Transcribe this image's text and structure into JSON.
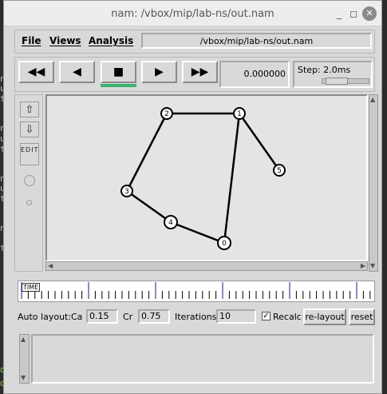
{
  "window": {
    "title": "nam: /vbox/mip/lab-ns/out.nam"
  },
  "menus": {
    "file": "File",
    "views": "Views",
    "analysis": "Analysis"
  },
  "filepath": "/vbox/mip/lab-ns/out.nam",
  "controls": {
    "rewind": "◀◀",
    "back": "◀",
    "stop": "■",
    "play": "▶",
    "fastforward": "▶▶",
    "time": "0.000000",
    "step_label": "Step: 2.0ms"
  },
  "tools": {
    "edit_label": "EDIT"
  },
  "nodes": [
    {
      "id": "0",
      "label": "0"
    },
    {
      "id": "1",
      "label": "1"
    },
    {
      "id": "2",
      "label": "2"
    },
    {
      "id": "3",
      "label": "3"
    },
    {
      "id": "4",
      "label": "4"
    },
    {
      "id": "5",
      "label": "5"
    }
  ],
  "links": [
    [
      "2",
      "1"
    ],
    [
      "2",
      "3"
    ],
    [
      "3",
      "4"
    ],
    [
      "4",
      "0"
    ],
    [
      "0",
      "1"
    ],
    [
      "1",
      "5"
    ]
  ],
  "timeline": {
    "label": "TIME"
  },
  "layout": {
    "auto_label": "Auto layout:",
    "ca_label": "Ca",
    "ca_value": "0.15",
    "cr_label": "Cr",
    "cr_value": "0.75",
    "iter_label": "Iterations",
    "iter_value": "10",
    "recalc_label": "Recalc",
    "recalc_checked": "✓",
    "relayout_label": "re-layout",
    "reset_label": "reset"
  },
  "background_terminal": {
    "lines": [
      "nti",
      "u",
      "ti",
      "nti",
      "u",
      "ti",
      "nti",
      "u",
      "ti",
      "nti",
      "ti"
    ],
    "green_lines": [
      "de",
      "de"
    ]
  }
}
